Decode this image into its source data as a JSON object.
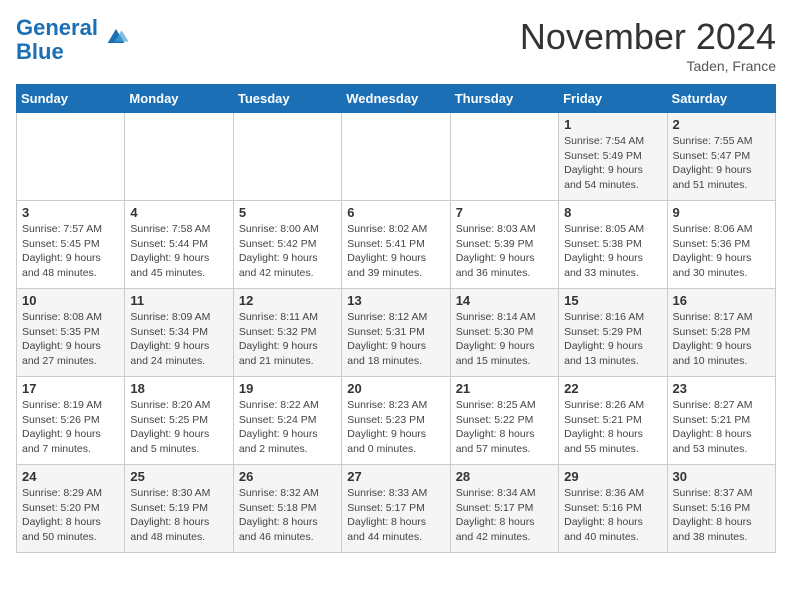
{
  "header": {
    "logo_line1": "General",
    "logo_line2": "Blue",
    "month": "November 2024",
    "location": "Taden, France"
  },
  "weekdays": [
    "Sunday",
    "Monday",
    "Tuesday",
    "Wednesday",
    "Thursday",
    "Friday",
    "Saturday"
  ],
  "weeks": [
    [
      {
        "day": "",
        "info": ""
      },
      {
        "day": "",
        "info": ""
      },
      {
        "day": "",
        "info": ""
      },
      {
        "day": "",
        "info": ""
      },
      {
        "day": "",
        "info": ""
      },
      {
        "day": "1",
        "info": "Sunrise: 7:54 AM\nSunset: 5:49 PM\nDaylight: 9 hours\nand 54 minutes."
      },
      {
        "day": "2",
        "info": "Sunrise: 7:55 AM\nSunset: 5:47 PM\nDaylight: 9 hours\nand 51 minutes."
      }
    ],
    [
      {
        "day": "3",
        "info": "Sunrise: 7:57 AM\nSunset: 5:45 PM\nDaylight: 9 hours\nand 48 minutes."
      },
      {
        "day": "4",
        "info": "Sunrise: 7:58 AM\nSunset: 5:44 PM\nDaylight: 9 hours\nand 45 minutes."
      },
      {
        "day": "5",
        "info": "Sunrise: 8:00 AM\nSunset: 5:42 PM\nDaylight: 9 hours\nand 42 minutes."
      },
      {
        "day": "6",
        "info": "Sunrise: 8:02 AM\nSunset: 5:41 PM\nDaylight: 9 hours\nand 39 minutes."
      },
      {
        "day": "7",
        "info": "Sunrise: 8:03 AM\nSunset: 5:39 PM\nDaylight: 9 hours\nand 36 minutes."
      },
      {
        "day": "8",
        "info": "Sunrise: 8:05 AM\nSunset: 5:38 PM\nDaylight: 9 hours\nand 33 minutes."
      },
      {
        "day": "9",
        "info": "Sunrise: 8:06 AM\nSunset: 5:36 PM\nDaylight: 9 hours\nand 30 minutes."
      }
    ],
    [
      {
        "day": "10",
        "info": "Sunrise: 8:08 AM\nSunset: 5:35 PM\nDaylight: 9 hours\nand 27 minutes."
      },
      {
        "day": "11",
        "info": "Sunrise: 8:09 AM\nSunset: 5:34 PM\nDaylight: 9 hours\nand 24 minutes."
      },
      {
        "day": "12",
        "info": "Sunrise: 8:11 AM\nSunset: 5:32 PM\nDaylight: 9 hours\nand 21 minutes."
      },
      {
        "day": "13",
        "info": "Sunrise: 8:12 AM\nSunset: 5:31 PM\nDaylight: 9 hours\nand 18 minutes."
      },
      {
        "day": "14",
        "info": "Sunrise: 8:14 AM\nSunset: 5:30 PM\nDaylight: 9 hours\nand 15 minutes."
      },
      {
        "day": "15",
        "info": "Sunrise: 8:16 AM\nSunset: 5:29 PM\nDaylight: 9 hours\nand 13 minutes."
      },
      {
        "day": "16",
        "info": "Sunrise: 8:17 AM\nSunset: 5:28 PM\nDaylight: 9 hours\nand 10 minutes."
      }
    ],
    [
      {
        "day": "17",
        "info": "Sunrise: 8:19 AM\nSunset: 5:26 PM\nDaylight: 9 hours\nand 7 minutes."
      },
      {
        "day": "18",
        "info": "Sunrise: 8:20 AM\nSunset: 5:25 PM\nDaylight: 9 hours\nand 5 minutes."
      },
      {
        "day": "19",
        "info": "Sunrise: 8:22 AM\nSunset: 5:24 PM\nDaylight: 9 hours\nand 2 minutes."
      },
      {
        "day": "20",
        "info": "Sunrise: 8:23 AM\nSunset: 5:23 PM\nDaylight: 9 hours\nand 0 minutes."
      },
      {
        "day": "21",
        "info": "Sunrise: 8:25 AM\nSunset: 5:22 PM\nDaylight: 8 hours\nand 57 minutes."
      },
      {
        "day": "22",
        "info": "Sunrise: 8:26 AM\nSunset: 5:21 PM\nDaylight: 8 hours\nand 55 minutes."
      },
      {
        "day": "23",
        "info": "Sunrise: 8:27 AM\nSunset: 5:21 PM\nDaylight: 8 hours\nand 53 minutes."
      }
    ],
    [
      {
        "day": "24",
        "info": "Sunrise: 8:29 AM\nSunset: 5:20 PM\nDaylight: 8 hours\nand 50 minutes."
      },
      {
        "day": "25",
        "info": "Sunrise: 8:30 AM\nSunset: 5:19 PM\nDaylight: 8 hours\nand 48 minutes."
      },
      {
        "day": "26",
        "info": "Sunrise: 8:32 AM\nSunset: 5:18 PM\nDaylight: 8 hours\nand 46 minutes."
      },
      {
        "day": "27",
        "info": "Sunrise: 8:33 AM\nSunset: 5:17 PM\nDaylight: 8 hours\nand 44 minutes."
      },
      {
        "day": "28",
        "info": "Sunrise: 8:34 AM\nSunset: 5:17 PM\nDaylight: 8 hours\nand 42 minutes."
      },
      {
        "day": "29",
        "info": "Sunrise: 8:36 AM\nSunset: 5:16 PM\nDaylight: 8 hours\nand 40 minutes."
      },
      {
        "day": "30",
        "info": "Sunrise: 8:37 AM\nSunset: 5:16 PM\nDaylight: 8 hours\nand 38 minutes."
      }
    ]
  ]
}
